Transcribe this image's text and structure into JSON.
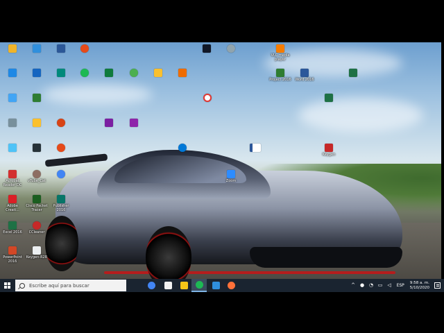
{
  "desktop": {
    "icons": [
      {
        "name": "icon-r1c1",
        "label": "",
        "color": "#f0b429"
      },
      {
        "name": "icon-r1c2",
        "label": "",
        "color": "#2f8fdd"
      },
      {
        "name": "icon-r1c3",
        "label": "",
        "color": "#2b5797"
      },
      {
        "name": "icon-r1c4",
        "label": "",
        "color": "#e64a19"
      },
      {
        "name": "icon-r1c5",
        "label": "",
        "color": "#111827"
      },
      {
        "name": "icon-r1c6",
        "label": "",
        "color": "#90a4ae"
      },
      {
        "name": "icon-vlc",
        "label": "VLC media player",
        "color": "#f57c00"
      },
      {
        "name": "icon-r2c1",
        "label": "",
        "color": "#1e88e5"
      },
      {
        "name": "icon-r2c2",
        "label": "",
        "color": "#1565c0"
      },
      {
        "name": "icon-r2c3",
        "label": "",
        "color": "#00897b"
      },
      {
        "name": "icon-r2c4",
        "label": "",
        "color": "#1db954"
      },
      {
        "name": "icon-r2c5",
        "label": "",
        "color": "#0f7b3d"
      },
      {
        "name": "icon-r2c6",
        "label": "",
        "color": "#4caf50"
      },
      {
        "name": "icon-r2c7",
        "label": "",
        "color": "#fbc02d"
      },
      {
        "name": "icon-r2c8",
        "label": "",
        "color": "#ef6c00"
      },
      {
        "name": "icon-project",
        "label": "Project 2016",
        "color": "#2e7d32"
      },
      {
        "name": "icon-word",
        "label": "Word 2016",
        "color": "#2b579a"
      },
      {
        "name": "icon-r2-right",
        "label": "",
        "color": "#1e7145"
      },
      {
        "name": "icon-r3c1",
        "label": "",
        "color": "#42a5f5"
      },
      {
        "name": "icon-r3c2",
        "label": "",
        "color": "#2e7d32"
      },
      {
        "name": "icon-r3c7",
        "label": "",
        "color": "#e53935"
      },
      {
        "name": "icon-excel-r3",
        "label": "",
        "color": "#1e7145"
      },
      {
        "name": "icon-r4c1",
        "label": "",
        "color": "#78909c"
      },
      {
        "name": "icon-r4c2",
        "label": "",
        "color": "#fbc02d"
      },
      {
        "name": "icon-r4c3",
        "label": "",
        "color": "#d84315"
      },
      {
        "name": "icon-winrar1",
        "label": "",
        "color": "#7b1fa2"
      },
      {
        "name": "icon-winrar2",
        "label": "",
        "color": "#8e24aa"
      },
      {
        "name": "icon-r5c1",
        "label": "",
        "color": "#4fc3f7"
      },
      {
        "name": "icon-r5c2",
        "label": "",
        "color": "#263238"
      },
      {
        "name": "icon-r5c3",
        "label": "",
        "color": "#e64a19"
      },
      {
        "name": "icon-edge",
        "label": "",
        "color": "#0078d7"
      },
      {
        "name": "icon-r5-word",
        "label": "",
        "color": "#2b579a"
      },
      {
        "name": "icon-keygen",
        "label": "Keygen",
        "color": "#c62828"
      },
      {
        "name": "icon-acrobat",
        "label": "Acrobat Reader DC",
        "color": "#d32f2f"
      },
      {
        "name": "icon-vtube",
        "label": "vTube_Cat",
        "color": "#8d6e63"
      },
      {
        "name": "icon-chrome-desk",
        "label": "",
        "color": "#4285f4"
      },
      {
        "name": "icon-zoom",
        "label": "Zoom",
        "color": "#2d8cff"
      },
      {
        "name": "icon-adobe",
        "label": "Adobe Creati...",
        "color": "#da1f26"
      },
      {
        "name": "icon-cisco",
        "label": "Cisco Packet Tracer",
        "color": "#1b5e20"
      },
      {
        "name": "icon-publisher",
        "label": "Publisher 2016",
        "color": "#077568"
      },
      {
        "name": "icon-excel",
        "label": "Excel 2016",
        "color": "#1e7145"
      },
      {
        "name": "icon-ccleaner",
        "label": "CCleaner",
        "color": "#c62828"
      },
      {
        "name": "icon-powerpoint",
        "label": "PowerPoint 2016",
        "color": "#d24726"
      },
      {
        "name": "icon-keygen-r2r",
        "label": "Keygen-R2R",
        "color": "#eceff1"
      }
    ]
  },
  "taskbar": {
    "search_placeholder": "Escribe aquí para buscar",
    "apps": [
      {
        "name": "taskbar-chrome",
        "color": "#4285f4"
      },
      {
        "name": "taskbar-store",
        "color": "#f2f2f2"
      },
      {
        "name": "taskbar-explorer",
        "color": "#f5c518"
      },
      {
        "name": "taskbar-spotify",
        "color": "#1db954"
      },
      {
        "name": "taskbar-photos",
        "color": "#2f8fdd"
      },
      {
        "name": "taskbar-firefox",
        "color": "#ff7139"
      }
    ],
    "language": "ESP",
    "time": "9:58 a. m.",
    "date": "5/10/2020"
  }
}
